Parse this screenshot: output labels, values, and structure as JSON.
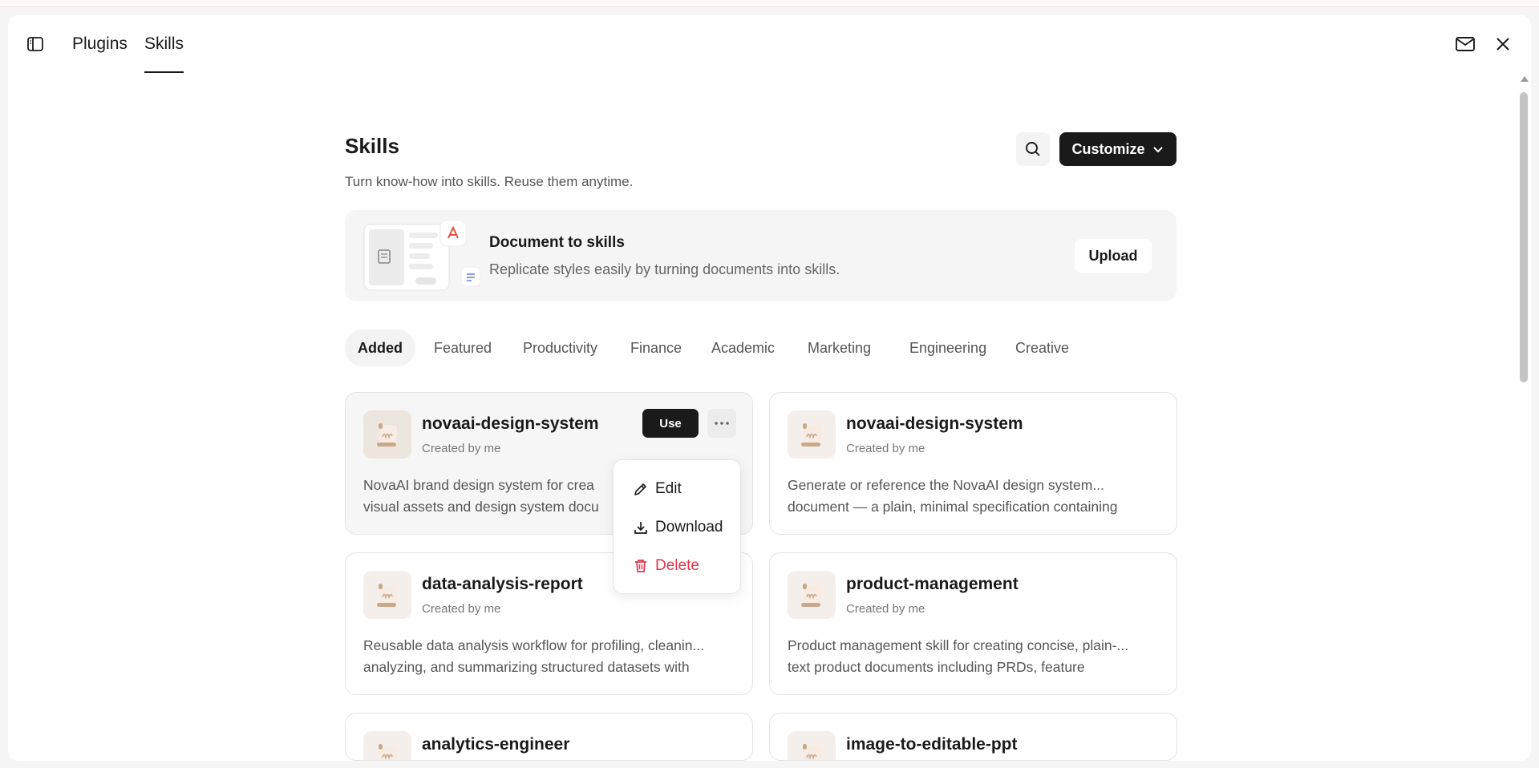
{
  "header": {
    "tabs": [
      {
        "label": "Plugins"
      },
      {
        "label": "Skills"
      }
    ]
  },
  "page": {
    "title": "Skills",
    "subtitle": "Turn know-how into skills. Reuse them anytime.",
    "customize_label": "Customize"
  },
  "banner": {
    "title": "Document to skills",
    "subtitle": "Replicate styles easily by turning documents into skills.",
    "upload_label": "Upload"
  },
  "categories": [
    {
      "label": "Added",
      "active": true
    },
    {
      "label": "Featured"
    },
    {
      "label": "Productivity"
    },
    {
      "label": "Finance"
    },
    {
      "label": "Academic"
    },
    {
      "label": "Marketing"
    },
    {
      "label": "Engineering"
    },
    {
      "label": "Creative"
    }
  ],
  "cards": [
    {
      "name": "novaai-design-system",
      "author": "Created by me",
      "desc1": "NovaAI brand design system for crea",
      "desc2": "visual assets and design system docu",
      "use_label": "Use"
    },
    {
      "name": "novaai-design-system",
      "author": "Created by me",
      "desc1": "Generate or reference the NovaAI design system...",
      "desc2": "document — a plain, minimal specification containing"
    },
    {
      "name": "data-analysis-report",
      "author": "Created by me",
      "desc1": "Reusable data analysis workflow for profiling, cleanin...",
      "desc2": "analyzing, and summarizing structured datasets with"
    },
    {
      "name": "product-management",
      "author": "Created by me",
      "desc1": "Product management skill for creating concise, plain-...",
      "desc2": "text product documents including PRDs, feature"
    },
    {
      "name": "analytics-engineer"
    },
    {
      "name": "image-to-editable-ppt"
    }
  ],
  "menu": {
    "edit": "Edit",
    "download": "Download",
    "delete": "Delete"
  },
  "icons": {
    "sidebar": "sidebar-toggle-icon",
    "mail": "mail-icon",
    "close": "close-icon",
    "search": "search-icon",
    "chevron": "chevron-down-icon",
    "more": "more-horizontal-icon",
    "edit": "pencil-icon",
    "download": "download-icon",
    "delete": "trash-icon",
    "skill": "scroll-icon",
    "pdf": "pdf-icon",
    "doc": "document-icon"
  },
  "colors": {
    "primary": "#1a1a1a",
    "danger": "#e0374b",
    "pdf_red": "#e74c3c",
    "doc_blue": "#5b7ff0",
    "scroll_tan": "#c9a88a"
  }
}
